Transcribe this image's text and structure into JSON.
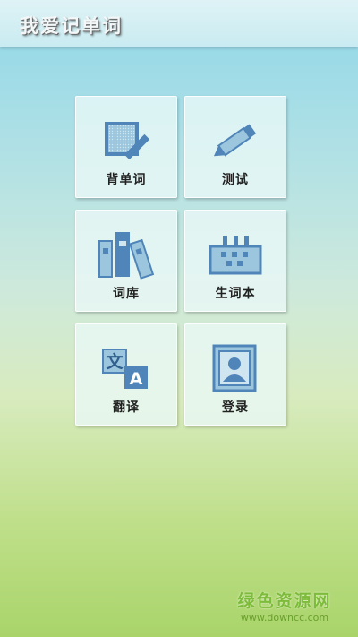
{
  "app": {
    "title": "我爱记单词"
  },
  "tiles": [
    {
      "label": "背单词",
      "icon": "edit-square-icon"
    },
    {
      "label": "测试",
      "icon": "pencil-icon"
    },
    {
      "label": "词库",
      "icon": "books-icon"
    },
    {
      "label": "生词本",
      "icon": "notebook-icon"
    },
    {
      "label": "翻译",
      "icon": "translate-icon",
      "glyph_left": "文",
      "glyph_right": "A"
    },
    {
      "label": "登录",
      "icon": "user-card-icon"
    }
  ],
  "watermark": {
    "title": "绿色资源网",
    "url": "www.downcc.com"
  },
  "colors": {
    "icon_blue": "#4f85b8",
    "icon_light": "#9cc6dd",
    "brand_green": "#7dbb3a"
  }
}
